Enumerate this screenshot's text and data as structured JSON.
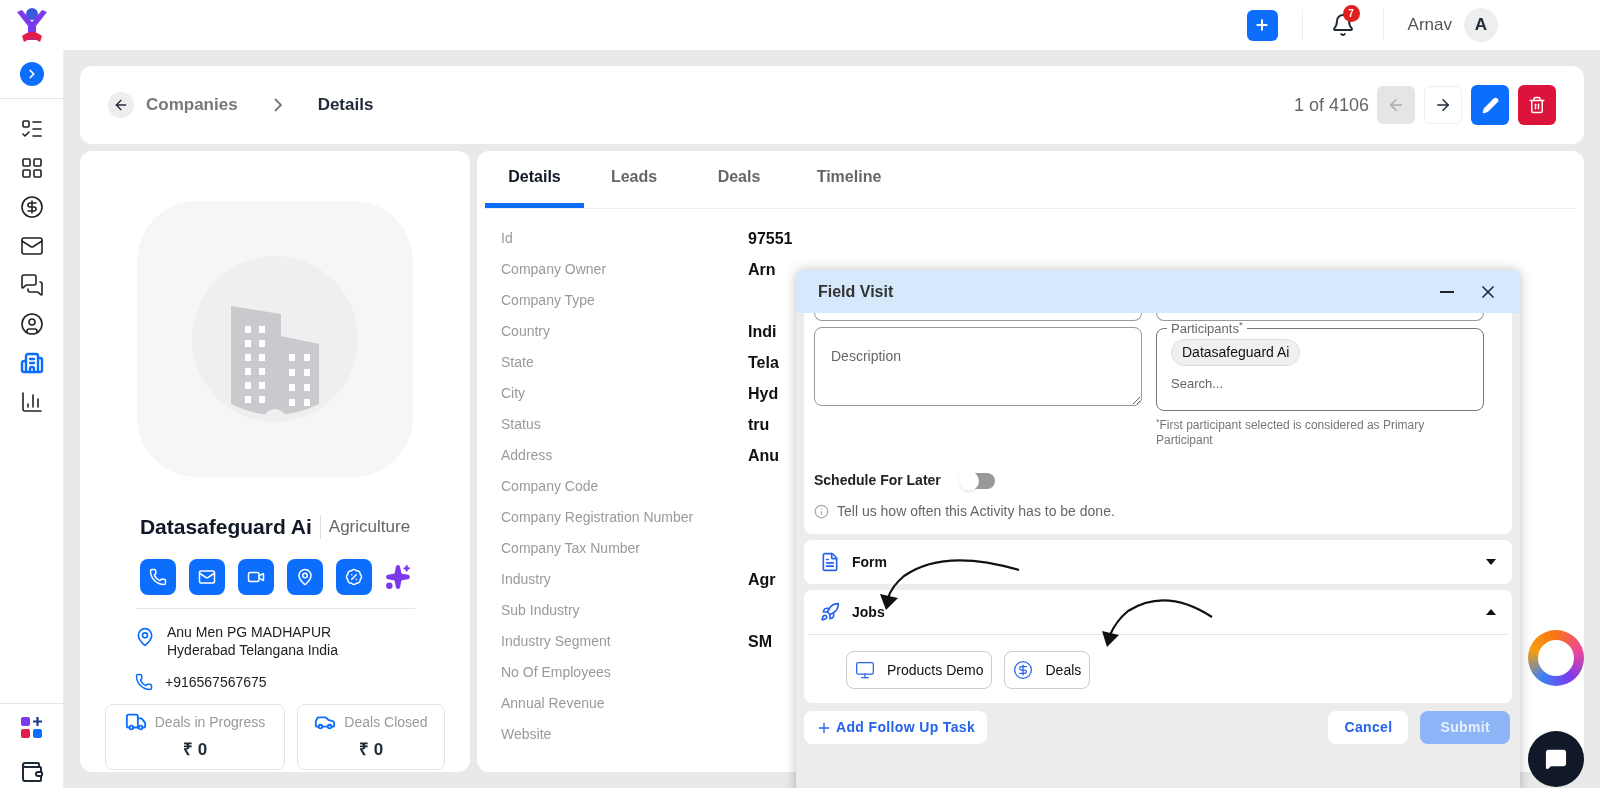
{
  "topbar": {
    "notification_count": "7",
    "user_name": "Arnav",
    "avatar_initial": "A"
  },
  "sidebar": {
    "items": [
      {
        "selected": false
      },
      {
        "selected": false
      },
      {
        "selected": false
      },
      {
        "selected": false
      },
      {
        "selected": false
      },
      {
        "selected": false
      },
      {
        "selected": true
      },
      {
        "selected": false
      }
    ]
  },
  "breadcrumb": {
    "parent": "Companies",
    "current": "Details"
  },
  "pager": {
    "text": "1 of 4106",
    "prev_disabled": true
  },
  "company": {
    "name": "Datasafeguard Ai",
    "industry": "Agriculture",
    "address_lines": [
      "Anu Men PG MADHAPUR",
      "Hyderabad Telangana India"
    ],
    "phone": "+916567567675",
    "stats": [
      {
        "label": "Deals in Progress",
        "value": "₹ 0"
      },
      {
        "label": "Deals Closed",
        "value": "₹ 0"
      }
    ]
  },
  "tabs": [
    {
      "label": "Details",
      "selected": true
    },
    {
      "label": "Leads",
      "selected": false
    },
    {
      "label": "Deals",
      "selected": false
    },
    {
      "label": "Timeline",
      "selected": false
    }
  ],
  "details": [
    {
      "label": "Id",
      "value": "97551"
    },
    {
      "label": "Company Owner",
      "value": "Arn"
    },
    {
      "label": "Company Type"
    },
    {
      "label": "Country",
      "value": "Indi"
    },
    {
      "label": "State",
      "value": "Tela"
    },
    {
      "label": "City",
      "value": "Hyd"
    },
    {
      "label": "Status",
      "value": "tru"
    },
    {
      "label": "Address",
      "value": "Anu"
    },
    {
      "label": "Company Code"
    },
    {
      "label": "Company Registration Number"
    },
    {
      "label": "Company Tax Number"
    },
    {
      "label": "Industry",
      "value": "Agr"
    },
    {
      "label": "Sub Industry"
    },
    {
      "label": "Industry Segment",
      "value": "SM"
    },
    {
      "label": "No Of Employees"
    },
    {
      "label": "Annual Revenue"
    },
    {
      "label": "Website"
    }
  ],
  "modal": {
    "title": "Field Visit",
    "description_placeholder": "Description",
    "participants_label": "Participants",
    "participants_required": "*",
    "participants": [
      "Datasafeguard Ai"
    ],
    "search_placeholder": "Search...",
    "note_mark": "*",
    "note": "First participant selected is considered as Primary Participant",
    "schedule_label": "Schedule For Later",
    "schedule_on": false,
    "hint": "Tell us how often this Activity has to be done.",
    "sections": [
      {
        "title": "Form",
        "expanded": false
      },
      {
        "title": "Jobs",
        "expanded": true,
        "jobs": [
          {
            "label": "Products Demo"
          },
          {
            "label": "Deals"
          }
        ]
      }
    ],
    "add_task": "Add Follow Up Task",
    "cancel": "Cancel",
    "submit": "Submit",
    "submit_disabled": true
  }
}
